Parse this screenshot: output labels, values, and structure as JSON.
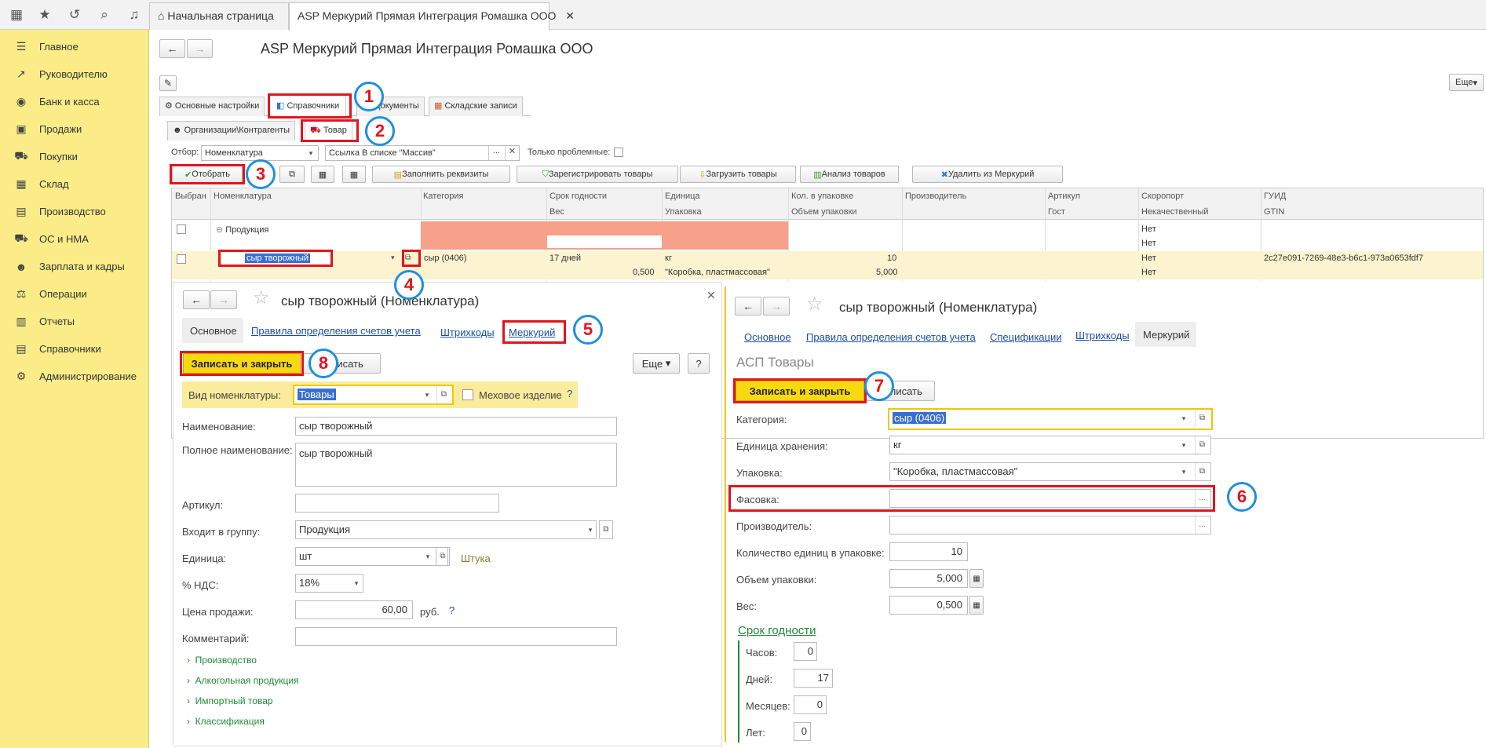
{
  "topbar": {
    "tabs": [
      "Начальная страница",
      "ASP Меркурий Прямая Интеграция Ромашка ООО"
    ]
  },
  "sidebar": {
    "items": [
      {
        "label": "Главное",
        "icon": "menu-icon"
      },
      {
        "label": "Руководителю",
        "icon": "trend-icon"
      },
      {
        "label": "Банк и касса",
        "icon": "coin-icon"
      },
      {
        "label": "Продажи",
        "icon": "bag-icon"
      },
      {
        "label": "Покупки",
        "icon": "cart-icon"
      },
      {
        "label": "Склад",
        "icon": "warehouse-icon"
      },
      {
        "label": "Производство",
        "icon": "factory-icon"
      },
      {
        "label": "ОС и НМА",
        "icon": "truck-icon"
      },
      {
        "label": "Зарплата и кадры",
        "icon": "person-icon"
      },
      {
        "label": "Операции",
        "icon": "operations-icon"
      },
      {
        "label": "Отчеты",
        "icon": "report-icon"
      },
      {
        "label": "Справочники",
        "icon": "book-icon"
      },
      {
        "label": "Администрирование",
        "icon": "gear-icon"
      }
    ]
  },
  "main": {
    "title": "ASP Меркурий Прямая Интеграция Ромашка ООО",
    "more_label": "Еще",
    "tabs": [
      "Основные настройки",
      "Справочники",
      "Документы",
      "Складские записи"
    ],
    "subtabs": [
      "Организации\\Контрагенты",
      "Товар"
    ],
    "filter": {
      "label": "Отбор:",
      "value": "Номенклатура",
      "link_value": "Ссылка В списке \"Массив\"",
      "problem_label": "Только проблемные:"
    },
    "toolbar": {
      "select": "Отобрать",
      "fill": "Заполнить реквизиты",
      "register": "Зарегистрировать товары",
      "load": "Загрузить товары",
      "analyze": "Анализ товаров",
      "delete": "Удалить из Меркурий"
    },
    "table": {
      "headers_row1": [
        "Выбран",
        "Номенклатура",
        "Категория",
        "Срок годности",
        "Единица",
        "Кол. в упаковке",
        "Производитель",
        "Артикул",
        "Скоропорт",
        "ГУИД"
      ],
      "headers_row2": [
        "Вес",
        "Упаковка",
        "Объем упаковки",
        "Гост",
        "Некачественный",
        "GTIN"
      ],
      "group": {
        "name": "Продукция",
        "skoroport": "Нет",
        "nekach": "Нет"
      },
      "row": {
        "name": "сыр творожный",
        "category": "сыр (0406)",
        "shelf": "17 дней",
        "unit": "кг",
        "qty": "10",
        "skoroport": "Нет",
        "guid": "2c27e091-7269-48e3-b6c1-973a0653fdf7",
        "weight": "0,500",
        "pack": "\"Коробка, пластмассовая\"",
        "volume": "5,000",
        "nekach": "Нет"
      }
    }
  },
  "left_form": {
    "title": "сыр творожный (Номенклатура)",
    "tabs": [
      "Основное",
      "Правила определения счетов учета",
      "Штрихкоды",
      "Меркурий"
    ],
    "save_close": "Записать и закрыть",
    "save": "Записать",
    "more": "Еще",
    "help": "?",
    "kind_label": "Вид номенклатуры:",
    "kind_value": "Товары",
    "fur_label": "Меховое изделие",
    "name_label": "Наименование:",
    "name_value": "сыр творожный",
    "fullname_label": "Полное наименование:",
    "fullname_value": "сыр творожный",
    "article_label": "Артикул:",
    "group_label": "Входит в группу:",
    "group_value": "Продукция",
    "unit_label": "Единица:",
    "unit_value": "шт",
    "unit_hint": "Штука",
    "vat_label": "% НДС:",
    "vat_value": "18%",
    "price_label": "Цена продажи:",
    "price_value": "60,00",
    "currency": "руб.",
    "comment_label": "Комментарий:",
    "sections": [
      "Производство",
      "Алкогольная продукция",
      "Импортный товар",
      "Классификация"
    ]
  },
  "right_form": {
    "title": "сыр творожный (Номенклатура)",
    "tabs": [
      "Основное",
      "Правила определения счетов учета",
      "Спецификации",
      "Штрихкоды",
      "Меркурий"
    ],
    "section_title": "АСП Товары",
    "save_close": "Записать и закрыть",
    "save": "Записать",
    "category_label": "Категория:",
    "category_value": "сыр (0406)",
    "storage_unit_label": "Единица хранения:",
    "storage_unit_value": "кг",
    "pack_label": "Упаковка:",
    "pack_value": "\"Коробка, пластмассовая\"",
    "fasovka_label": "Фасовка:",
    "producer_label": "Производитель:",
    "qty_pack_label": "Количество единиц в упаковке:",
    "qty_pack_value": "10",
    "volume_label": "Объем упаковки:",
    "volume_value": "5,000",
    "weight_label": "Вес:",
    "weight_value": "0,500",
    "shelf_title": "Срок годности",
    "hours_label": "Часов:",
    "hours_value": "0",
    "days_label": "Дней:",
    "days_value": "17",
    "months_label": "Месяцев:",
    "months_value": "0",
    "years_label": "Лет:",
    "years_value": "0"
  },
  "callouts": [
    "1",
    "2",
    "3",
    "4",
    "5",
    "6",
    "7",
    "8"
  ],
  "colors": {
    "sidebar": "#fbec88",
    "highlight": "#f7d90f",
    "callout_border": "#1e8fe0",
    "red": "#e2141e",
    "salmon": "#f7a08a"
  }
}
